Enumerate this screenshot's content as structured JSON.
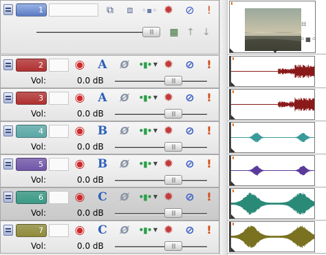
{
  "video_track": {
    "number": "1",
    "color": "#6f8fd0",
    "icons": [
      "compositing-mode-icon",
      "parent-pan-icon",
      "bus-route-icon",
      "track-fx-icon",
      "mute-icon",
      "solo-icon",
      "make-compositing-child-icon",
      "up-icon",
      "down-icon"
    ]
  },
  "audio_tracks": [
    {
      "number": "2",
      "color": "#b03030",
      "panning": "A",
      "vol_label": "Vol:",
      "vol_value": "0.0 dB",
      "wave_color": "#8a1a1a",
      "selected": false
    },
    {
      "number": "3",
      "color": "#b03030",
      "panning": "A",
      "vol_label": "Vol:",
      "vol_value": "0.0 dB",
      "wave_color": "#8a1a1a",
      "selected": false
    },
    {
      "number": "4",
      "color": "#5aa7a7",
      "panning": "B",
      "vol_label": "Vol:",
      "vol_value": "0.0 dB",
      "wave_color": "#3a9a9a",
      "selected": false
    },
    {
      "number": "5",
      "color": "#7055a8",
      "panning": "B",
      "vol_label": "Vol:",
      "vol_value": "0.0 dB",
      "wave_color": "#5a3a9a",
      "selected": false
    },
    {
      "number": "6",
      "color": "#3a9a86",
      "panning": "C",
      "vol_label": "Vol:",
      "vol_value": "0.0 dB",
      "wave_color": "#2a8a78",
      "selected": true
    },
    {
      "number": "7",
      "color": "#8f8a3a",
      "panning": "C",
      "vol_label": "Vol:",
      "vol_value": "0.0 dB",
      "wave_color": "#7a7220",
      "selected": false
    }
  ],
  "colors": {
    "border": "#a9a9a9",
    "header_bg": "#ececec",
    "timeline_bg": "#ffffff"
  }
}
